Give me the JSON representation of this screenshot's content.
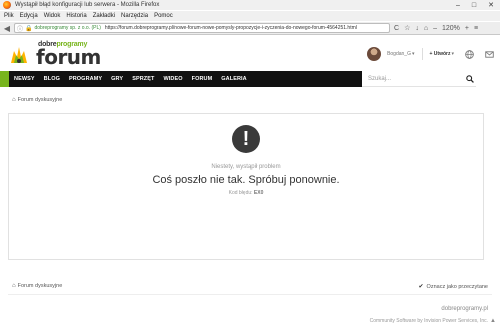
{
  "window": {
    "title": "Wystąpił błąd konfiguracji lub serwera - Mozilla Firefox",
    "min": "–",
    "max": "□",
    "close": "✕"
  },
  "menubar": [
    "Plik",
    "Edycja",
    "Widok",
    "Historia",
    "Zakładki",
    "Narzędzia",
    "Pomoc"
  ],
  "browser": {
    "back": "◀",
    "info": "ⓘ",
    "lock": "🔒",
    "site_identity": "dobreprogramy sp. z o.o. (PL)",
    "url": "https://forum.dobreprogramy.pl/nowe-forum-nowe-pomysly-propozycje-i-zyczenia-do-nowego-forum-4564251.html",
    "reload": "C",
    "star": "☆",
    "download": "↓",
    "home": "⌂",
    "zoom": "120%",
    "zoom_minus": "–",
    "zoom_plus": "+",
    "menu": "≡"
  },
  "site": {
    "brand_top_part1": "dobre",
    "brand_top_part2": "programy",
    "brand_main": "forum",
    "user_name": "Bogdan_G",
    "user_caret": "▾",
    "create_label": "+ Utwórz",
    "create_caret": "▾"
  },
  "nav": {
    "items": [
      "NEWSY",
      "BLOG",
      "PROGRAMY",
      "GRY",
      "SPRZĘT",
      "WIDEO",
      "FORUM",
      "GALERIA"
    ],
    "search_placeholder": "Szukaj..."
  },
  "breadcrumb": {
    "home_icon": "⌂",
    "label": "Forum dyskusyjne"
  },
  "error": {
    "icon": "!",
    "small_text": "Niestety, wystąpił problem",
    "big_text": "Coś poszło nie tak. Spróbuj ponownie.",
    "code_label": "Kod błędu:",
    "code_value": "EX0"
  },
  "footer": {
    "home_icon": "⌂",
    "breadcrumb_label": "Forum dyskusyjne",
    "check_icon": "✔",
    "mark_read_label": "Oznacz jako przeczytane",
    "site_name": "dobreprogramy.pl",
    "credit": "Community Software by Invision Power Services, Inc.",
    "scroll_up_icon": "▲"
  },
  "colors": {
    "accent_green": "#78b51d",
    "nav_black": "#111111",
    "error_icon_bg": "#3a3a3a"
  }
}
